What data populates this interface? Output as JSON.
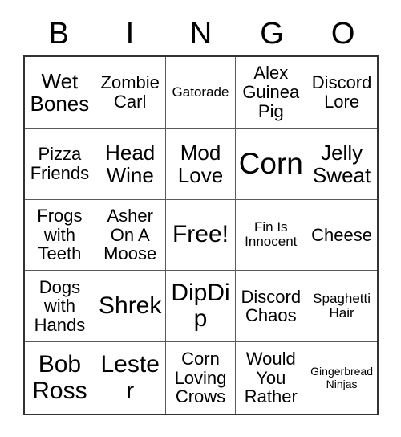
{
  "header": {
    "letters": [
      "B",
      "I",
      "N",
      "G",
      "O"
    ]
  },
  "grid": {
    "rows": 5,
    "columns": 5,
    "cells": [
      {
        "label": "Wet Bones",
        "size": "lg"
      },
      {
        "label": "Zombie Carl",
        "size": "md"
      },
      {
        "label": "Gatorade",
        "size": "sm"
      },
      {
        "label": "Alex Guinea Pig",
        "size": "md"
      },
      {
        "label": "Discord Lore",
        "size": "md"
      },
      {
        "label": "Pizza Friends",
        "size": "md"
      },
      {
        "label": "Head Wine",
        "size": "lg"
      },
      {
        "label": "Mod Love",
        "size": "lg"
      },
      {
        "label": "Corn",
        "size": "xxl"
      },
      {
        "label": "Jelly Sweat",
        "size": "lg"
      },
      {
        "label": "Frogs with Teeth",
        "size": "md"
      },
      {
        "label": "Asher On A Moose",
        "size": "md"
      },
      {
        "label": "Free!",
        "size": "xl"
      },
      {
        "label": "Fin Is Innocent",
        "size": "sm"
      },
      {
        "label": "Cheese",
        "size": "md"
      },
      {
        "label": "Dogs with Hands",
        "size": "md"
      },
      {
        "label": "Shrek",
        "size": "xl"
      },
      {
        "label": "DipDip",
        "size": "xl"
      },
      {
        "label": "Discord Chaos",
        "size": "md"
      },
      {
        "label": "Spaghetti Hair",
        "size": "sm"
      },
      {
        "label": "Bob Ross",
        "size": "xl"
      },
      {
        "label": "Lester",
        "size": "xl"
      },
      {
        "label": "Corn Loving Crows",
        "size": "md"
      },
      {
        "label": "Would You Rather",
        "size": "md"
      },
      {
        "label": "Gingerbread Ninjas",
        "size": "xs"
      }
    ]
  },
  "colors": {
    "background": "#ffffff",
    "text": "#000000",
    "outer_border": "#333333",
    "inner_border": "#5a5a5a"
  }
}
